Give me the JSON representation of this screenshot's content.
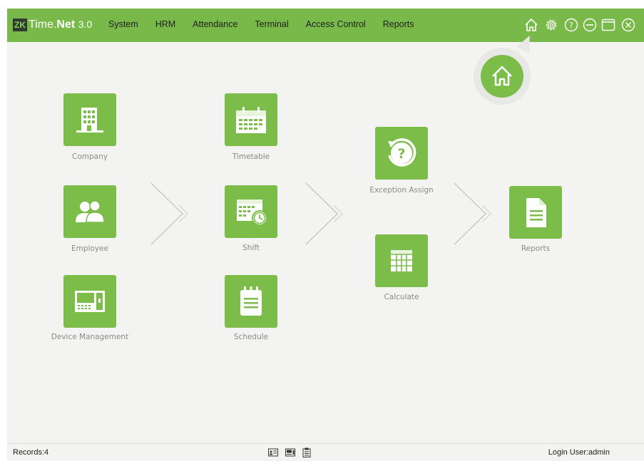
{
  "app": {
    "logo_mark": "ZK",
    "logo_text": "Time.",
    "logo_bold": "Net",
    "version": "3.0"
  },
  "menu": [
    "System",
    "HRM",
    "Attendance",
    "Terminal",
    "Access Control",
    "Reports"
  ],
  "window_controls": [
    "home-icon",
    "settings-icon",
    "help-icon",
    "minimize-icon",
    "maximize-icon",
    "close-icon"
  ],
  "tiles": {
    "company": "Company",
    "employee": "Employee",
    "device": "Device Management",
    "timetable": "Timetable",
    "shift": "Shift",
    "schedule": "Schedule",
    "exception": "Exception Assign",
    "calculate": "Calculate",
    "reports": "Reports"
  },
  "status": {
    "records": "Records:4",
    "login": "Login User:admin"
  },
  "colors": {
    "accent": "#79b94a",
    "tile": "#7cbd4a",
    "background": "#f3f3f1"
  }
}
